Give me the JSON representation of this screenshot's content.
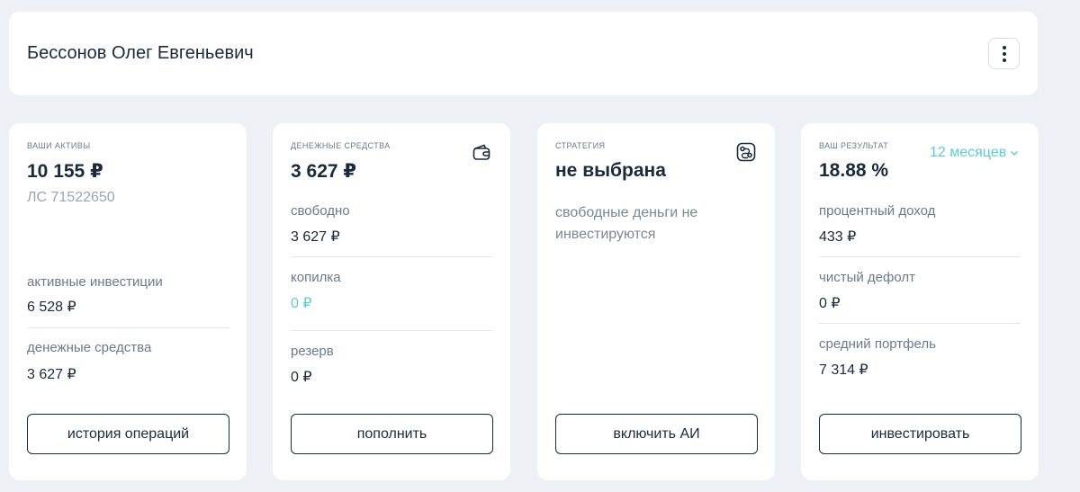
{
  "header": {
    "name": "Бессонов Олег Евгеньевич"
  },
  "assets": {
    "caption": "ваши активы",
    "total": "10 155 ₽",
    "account": "ЛС 71522650",
    "rows": [
      {
        "label": "активные инвестиции",
        "value": "6 528 ₽"
      },
      {
        "label": "денежные средства",
        "value": "3 627 ₽"
      }
    ],
    "button": "история операций"
  },
  "cash": {
    "caption": "денежные средства",
    "total": "3 627 ₽",
    "icon": "wallet-icon",
    "rows": [
      {
        "label": "свободно",
        "value": "3 627 ₽"
      },
      {
        "label": "копилка",
        "value": "0 ₽"
      },
      {
        "label": "резерв",
        "value": "0 ₽"
      }
    ],
    "button": "пополнить"
  },
  "strategy": {
    "caption": "стратегия",
    "value": "не выбрана",
    "icon": "route-icon",
    "description": "свободные деньги не инвестируются",
    "button": "включить АИ"
  },
  "result": {
    "caption": "ваш результат",
    "value": "18.88 %",
    "period": "12 месяцев",
    "rows": [
      {
        "label": "процентный доход",
        "value": "433 ₽"
      },
      {
        "label": "чистый дефолт",
        "value": "0 ₽"
      },
      {
        "label": "средний портфель",
        "value": "7 314 ₽"
      }
    ],
    "button": "инвестировать"
  },
  "colors": {
    "accent": "#5ccbd8",
    "text": "#1b2a3b",
    "muted": "#6b7a8c",
    "background": "#edf0f4"
  }
}
